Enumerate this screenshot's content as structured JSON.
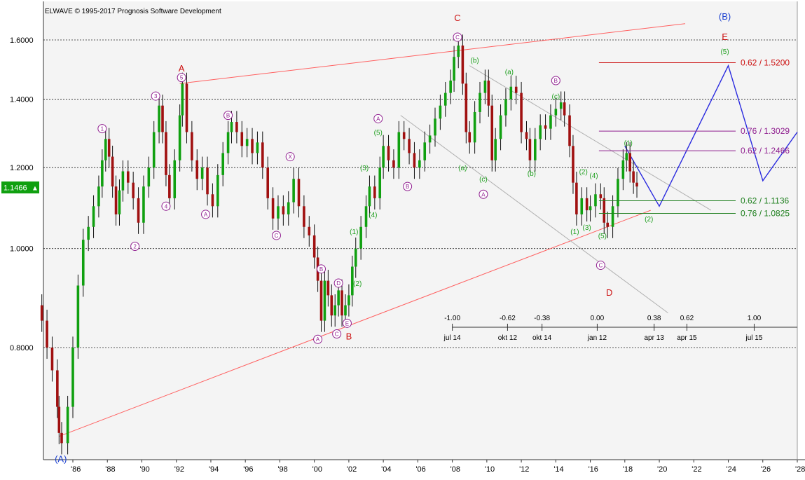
{
  "header": {
    "copyright": "ELWAVE © 1995-2017 Prognosis Software Development"
  },
  "price_badge": {
    "value": "1.1466",
    "arrow": "▲",
    "color": "#10a010"
  },
  "chart_data": {
    "type": "candlestick",
    "title": "",
    "xlabel": "",
    "ylabel": "",
    "scale": "log",
    "ylim": [
      0.615,
      1.7
    ],
    "xlim": [
      1984.0,
      2028.0
    ],
    "grid": true,
    "y_ticks": [
      1.6,
      1.4,
      1.2,
      1.0,
      0.8
    ],
    "y_tick_labels": [
      "1.6000",
      "1.4000",
      "1.2000",
      "1.0000",
      "0.8000"
    ],
    "x_ticks": [
      1986,
      1988,
      1990,
      1992,
      1994,
      1996,
      1998,
      2000,
      2002,
      2004,
      2006,
      2008,
      2010,
      2012,
      2014,
      2016,
      2018,
      2020,
      2022,
      2024,
      2026,
      2028
    ],
    "x_tick_labels": [
      "'86",
      "'88",
      "'90",
      "'92",
      "'94",
      "'96",
      "'98",
      "'00",
      "'02",
      "'04",
      "'06",
      "'08",
      "'10",
      "'12",
      "'14",
      "'16",
      "'18",
      "'20",
      "'22",
      "'24",
      "'26",
      "'28"
    ],
    "colors": {
      "up": "#10a010",
      "down": "#a01010",
      "primary_wave": "#cc1010",
      "intermediate_wave": "#902090",
      "minor_wave": "#20a020",
      "cycle_wave": "#1a3fd0",
      "channel": "#ff6060",
      "grey_channel": "#b0b0b0",
      "projection": "#2a2adf"
    },
    "price_path": [
      [
        1984.0,
        0.88
      ],
      [
        1984.2,
        0.85
      ],
      [
        1984.5,
        0.8
      ],
      [
        1984.8,
        0.76
      ],
      [
        1985.1,
        0.7
      ],
      [
        1985.2,
        0.66
      ],
      [
        1985.35,
        0.645
      ],
      [
        1985.7,
        0.7
      ],
      [
        1986.0,
        0.8
      ],
      [
        1986.3,
        0.92
      ],
      [
        1986.6,
        1.02
      ],
      [
        1986.9,
        1.05
      ],
      [
        1987.2,
        1.1
      ],
      [
        1987.5,
        1.15
      ],
      [
        1987.7,
        1.22
      ],
      [
        1987.9,
        1.28
      ],
      [
        1988.1,
        1.23
      ],
      [
        1988.3,
        1.15
      ],
      [
        1988.5,
        1.08
      ],
      [
        1988.7,
        1.14
      ],
      [
        1988.9,
        1.19
      ],
      [
        1989.2,
        1.16
      ],
      [
        1989.5,
        1.12
      ],
      [
        1989.8,
        1.06
      ],
      [
        1990.1,
        1.15
      ],
      [
        1990.4,
        1.2
      ],
      [
        1990.7,
        1.3
      ],
      [
        1991.0,
        1.38
      ],
      [
        1991.2,
        1.3
      ],
      [
        1991.4,
        1.18
      ],
      [
        1991.6,
        1.12
      ],
      [
        1991.9,
        1.22
      ],
      [
        1992.2,
        1.35
      ],
      [
        1992.35,
        1.45
      ],
      [
        1992.6,
        1.3
      ],
      [
        1992.9,
        1.22
      ],
      [
        1993.2,
        1.17
      ],
      [
        1993.5,
        1.2
      ],
      [
        1993.8,
        1.13
      ],
      [
        1994.1,
        1.1
      ],
      [
        1994.4,
        1.18
      ],
      [
        1994.7,
        1.24
      ],
      [
        1995.0,
        1.3
      ],
      [
        1995.2,
        1.33
      ],
      [
        1995.5,
        1.3
      ],
      [
        1995.8,
        1.26
      ],
      [
        1996.1,
        1.28
      ],
      [
        1996.4,
        1.24
      ],
      [
        1996.7,
        1.27
      ],
      [
        1997.0,
        1.2
      ],
      [
        1997.3,
        1.12
      ],
      [
        1997.6,
        1.07
      ],
      [
        1997.9,
        1.1
      ],
      [
        1998.2,
        1.08
      ],
      [
        1998.5,
        1.11
      ],
      [
        1998.8,
        1.17
      ],
      [
        1999.1,
        1.1
      ],
      [
        1999.4,
        1.05
      ],
      [
        1999.7,
        1.03
      ],
      [
        2000.0,
        0.98
      ],
      [
        2000.2,
        0.93
      ],
      [
        2000.4,
        0.85
      ],
      [
        2000.6,
        0.93
      ],
      [
        2000.8,
        0.9
      ],
      [
        2001.0,
        0.86
      ],
      [
        2001.2,
        0.88
      ],
      [
        2001.4,
        0.91
      ],
      [
        2001.6,
        0.86
      ],
      [
        2001.8,
        0.88
      ],
      [
        2002.0,
        0.9
      ],
      [
        2002.2,
        0.96
      ],
      [
        2002.4,
        1.0
      ],
      [
        2002.7,
        1.05
      ],
      [
        2003.0,
        1.1
      ],
      [
        2003.2,
        1.15
      ],
      [
        2003.5,
        1.12
      ],
      [
        2003.8,
        1.2
      ],
      [
        2004.0,
        1.26
      ],
      [
        2004.3,
        1.22
      ],
      [
        2004.6,
        1.2
      ],
      [
        2004.9,
        1.3
      ],
      [
        2005.2,
        1.28
      ],
      [
        2005.5,
        1.24
      ],
      [
        2005.8,
        1.2
      ],
      [
        2006.1,
        1.22
      ],
      [
        2006.4,
        1.27
      ],
      [
        2006.7,
        1.29
      ],
      [
        2007.0,
        1.34
      ],
      [
        2007.3,
        1.38
      ],
      [
        2007.6,
        1.42
      ],
      [
        2007.9,
        1.46
      ],
      [
        2008.1,
        1.54
      ],
      [
        2008.35,
        1.58
      ],
      [
        2008.6,
        1.45
      ],
      [
        2008.8,
        1.3
      ],
      [
        2009.0,
        1.27
      ],
      [
        2009.3,
        1.36
      ],
      [
        2009.6,
        1.42
      ],
      [
        2009.9,
        1.46
      ],
      [
        2010.1,
        1.38
      ],
      [
        2010.3,
        1.22
      ],
      [
        2010.5,
        1.28
      ],
      [
        2010.8,
        1.35
      ],
      [
        2011.1,
        1.4
      ],
      [
        2011.4,
        1.44
      ],
      [
        2011.7,
        1.42
      ],
      [
        2012.0,
        1.3
      ],
      [
        2012.3,
        1.28
      ],
      [
        2012.5,
        1.22
      ],
      [
        2012.8,
        1.28
      ],
      [
        2013.1,
        1.32
      ],
      [
        2013.4,
        1.31
      ],
      [
        2013.7,
        1.35
      ],
      [
        2014.0,
        1.37
      ],
      [
        2014.3,
        1.39
      ],
      [
        2014.5,
        1.35
      ],
      [
        2014.8,
        1.26
      ],
      [
        2015.0,
        1.16
      ],
      [
        2015.2,
        1.08
      ],
      [
        2015.5,
        1.12
      ],
      [
        2015.8,
        1.09
      ],
      [
        2016.0,
        1.1
      ],
      [
        2016.3,
        1.13
      ],
      [
        2016.6,
        1.12
      ],
      [
        2016.8,
        1.06
      ],
      [
        2017.0,
        1.05
      ],
      [
        2017.3,
        1.1
      ],
      [
        2017.6,
        1.17
      ],
      [
        2017.9,
        1.22
      ],
      [
        2018.1,
        1.24
      ],
      [
        2018.3,
        1.19
      ],
      [
        2018.5,
        1.16
      ],
      [
        2018.7,
        1.15
      ]
    ],
    "channels": [
      {
        "name": "upper",
        "kind": "red",
        "points": [
          [
            1992.2,
            1.45
          ],
          [
            2021.5,
            1.66
          ]
        ]
      },
      {
        "name": "lower",
        "kind": "red",
        "points": [
          [
            1985.2,
            0.655
          ],
          [
            2019.5,
            1.09
          ]
        ]
      },
      {
        "name": "grey-upper",
        "kind": "grey",
        "points": [
          [
            2009.0,
            1.51
          ],
          [
            2023.0,
            1.09
          ]
        ]
      },
      {
        "name": "grey-lower",
        "kind": "grey",
        "points": [
          [
            2005.0,
            1.35
          ],
          [
            2020.5,
            0.865
          ]
        ]
      },
      {
        "name": "blue-path",
        "kind": "blue",
        "points": [
          [
            2018.0,
            1.26
          ],
          [
            2020.0,
            1.1
          ],
          [
            2024.0,
            1.51
          ],
          [
            2026.0,
            1.165
          ],
          [
            2028.0,
            1.3
          ]
        ]
      }
    ],
    "fib_levels": [
      {
        "label": "0.62 / 1.5200",
        "value": 1.52,
        "x_start": 2016.5,
        "color": "#cc1010"
      },
      {
        "label": "0.76 / 1.3029",
        "value": 1.3029,
        "x_start": 2016.5,
        "color": "#902090"
      },
      {
        "label": "0.62 / 1.2466",
        "value": 1.2466,
        "x_start": 2016.5,
        "color": "#902090"
      },
      {
        "label": "0.62 / 1.1136",
        "value": 1.1136,
        "x_start": 2016.5,
        "color": "#208020"
      },
      {
        "label": "0.76 / 1.0825",
        "value": 1.0825,
        "x_start": 2016.5,
        "color": "#208020"
      }
    ],
    "wave_labels": [
      {
        "text": "C",
        "x": 2008.3,
        "y": 1.68,
        "kind": "primary"
      },
      {
        "text": "A",
        "x": 1992.3,
        "y": 1.5,
        "kind": "primary"
      },
      {
        "text": "B",
        "x": 2002.0,
        "y": 0.82,
        "kind": "primary"
      },
      {
        "text": "D",
        "x": 2017.1,
        "y": 0.905,
        "kind": "primary"
      },
      {
        "text": "E",
        "x": 2023.8,
        "y": 1.61,
        "kind": "primary"
      },
      {
        "text": "(B)",
        "x": 2023.8,
        "y": 1.685,
        "kind": "cycle"
      },
      {
        "text": "(A)",
        "x": 1985.3,
        "y": 0.622,
        "kind": "cycle"
      },
      {
        "text": "1",
        "x": 1987.7,
        "y": 1.31,
        "kind": "intermediate"
      },
      {
        "text": "2",
        "x": 1989.6,
        "y": 1.005,
        "kind": "intermediate"
      },
      {
        "text": "3",
        "x": 1990.8,
        "y": 1.41,
        "kind": "intermediate"
      },
      {
        "text": "4",
        "x": 1991.4,
        "y": 1.1,
        "kind": "intermediate"
      },
      {
        "text": "5",
        "x": 1992.3,
        "y": 1.47,
        "kind": "intermediate"
      },
      {
        "text": "A",
        "x": 1993.7,
        "y": 1.08,
        "kind": "intermediate"
      },
      {
        "text": "B",
        "x": 1995.0,
        "y": 1.35,
        "kind": "intermediate"
      },
      {
        "text": "C",
        "x": 1997.8,
        "y": 1.03,
        "kind": "intermediate"
      },
      {
        "text": "X",
        "x": 1998.6,
        "y": 1.23,
        "kind": "intermediate"
      },
      {
        "text": "A",
        "x": 2000.2,
        "y": 0.815,
        "kind": "intermediate"
      },
      {
        "text": "B",
        "x": 2000.4,
        "y": 0.955,
        "kind": "intermediate"
      },
      {
        "text": "C",
        "x": 2001.3,
        "y": 0.825,
        "kind": "intermediate"
      },
      {
        "text": "D",
        "x": 2001.4,
        "y": 0.925,
        "kind": "intermediate"
      },
      {
        "text": "E",
        "x": 2001.9,
        "y": 0.845,
        "kind": "intermediate"
      },
      {
        "text": "A",
        "x": 2003.7,
        "y": 1.34,
        "kind": "intermediate"
      },
      {
        "text": "B",
        "x": 2005.4,
        "y": 1.15,
        "kind": "intermediate"
      },
      {
        "text": "C",
        "x": 2008.3,
        "y": 1.61,
        "kind": "intermediate"
      },
      {
        "text": "A",
        "x": 2009.8,
        "y": 1.13,
        "kind": "intermediate"
      },
      {
        "text": "B",
        "x": 2014.0,
        "y": 1.46,
        "kind": "intermediate"
      },
      {
        "text": "C",
        "x": 2016.6,
        "y": 0.963,
        "kind": "intermediate"
      },
      {
        "text": "(b)",
        "x": 2009.3,
        "y": 1.53,
        "kind": "minor"
      },
      {
        "text": "(a)",
        "x": 2008.6,
        "y": 1.2,
        "kind": "minor"
      },
      {
        "text": "(c)",
        "x": 2009.8,
        "y": 1.17,
        "kind": "minor"
      },
      {
        "text": "(a)",
        "x": 2011.3,
        "y": 1.49,
        "kind": "minor"
      },
      {
        "text": "(b)",
        "x": 2012.6,
        "y": 1.185,
        "kind": "minor"
      },
      {
        "text": "(c)",
        "x": 2014.0,
        "y": 1.41,
        "kind": "minor"
      },
      {
        "text": "(5)",
        "x": 2003.7,
        "y": 1.3,
        "kind": "minor"
      },
      {
        "text": "(3)",
        "x": 2002.9,
        "y": 1.2,
        "kind": "minor"
      },
      {
        "text": "(4)",
        "x": 2003.4,
        "y": 1.08,
        "kind": "minor"
      },
      {
        "text": "(1)",
        "x": 2002.3,
        "y": 1.04,
        "kind": "minor"
      },
      {
        "text": "(2)",
        "x": 2002.5,
        "y": 0.925,
        "kind": "minor"
      },
      {
        "text": "(1)",
        "x": 2015.1,
        "y": 1.04,
        "kind": "minor"
      },
      {
        "text": "(2)",
        "x": 2015.6,
        "y": 1.19,
        "kind": "minor"
      },
      {
        "text": "(3)",
        "x": 2015.8,
        "y": 1.05,
        "kind": "minor"
      },
      {
        "text": "(4)",
        "x": 2016.2,
        "y": 1.18,
        "kind": "minor"
      },
      {
        "text": "(5)",
        "x": 2016.7,
        "y": 1.03,
        "kind": "minor"
      },
      {
        "text": "(1)",
        "x": 2018.2,
        "y": 1.27,
        "kind": "minor"
      },
      {
        "text": "(2)",
        "x": 2019.4,
        "y": 1.07,
        "kind": "minor"
      },
      {
        "text": "(5)",
        "x": 2023.8,
        "y": 1.56,
        "kind": "minor"
      }
    ],
    "time_ruler": {
      "ratios": [
        "-1.00",
        "-0.62",
        "-0.38",
        "0.00",
        "0.38",
        "0.62",
        "1.00"
      ],
      "dates": [
        "jul 14",
        "okt 12",
        "okt 14",
        "jan 12",
        "apr 13",
        "apr 15",
        "jul 15"
      ],
      "x": [
        2008.0,
        2011.2,
        2013.2,
        2016.4,
        2019.7,
        2021.6,
        2025.5
      ]
    }
  }
}
